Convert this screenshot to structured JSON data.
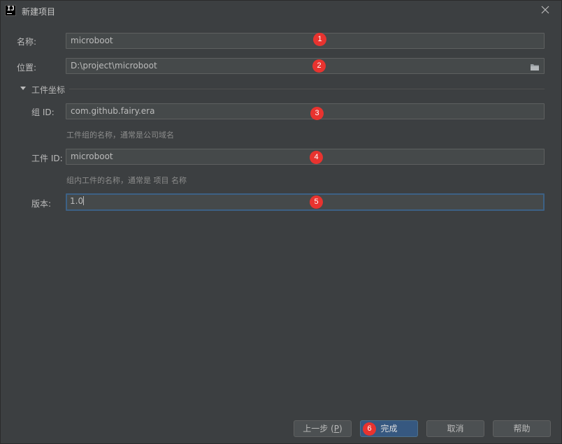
{
  "window": {
    "title": "新建项目",
    "app_icon_text": "IJ"
  },
  "form": {
    "name": {
      "label": "名称:",
      "value": "microboot"
    },
    "location": {
      "label": "位置:",
      "value": "D:\\project\\microboot"
    },
    "artifact_coordinates": {
      "section_label": "工件坐标",
      "group_id": {
        "label": "组 ID:",
        "value": "com.github.fairy.era",
        "hint": "工件组的名称，通常是公司域名"
      },
      "artifact_id": {
        "label": "工件 ID:",
        "value": "microboot",
        "hint": "组内工件的名称，通常是 项目 名称"
      },
      "version": {
        "label": "版本:",
        "value": "1.0"
      }
    }
  },
  "annotations": [
    "1",
    "2",
    "3",
    "4",
    "5",
    "6"
  ],
  "footer": {
    "previous": {
      "label": "上一步 (",
      "mnemonic": "P",
      "suffix": ")"
    },
    "finish": "完成",
    "cancel": "取消",
    "help": "帮助"
  },
  "colors": {
    "background": "#3c3f41",
    "field_background": "#45494a",
    "focus_border": "#3d6185",
    "primary_button": "#365880",
    "annotation_badge": "#e8332f"
  }
}
